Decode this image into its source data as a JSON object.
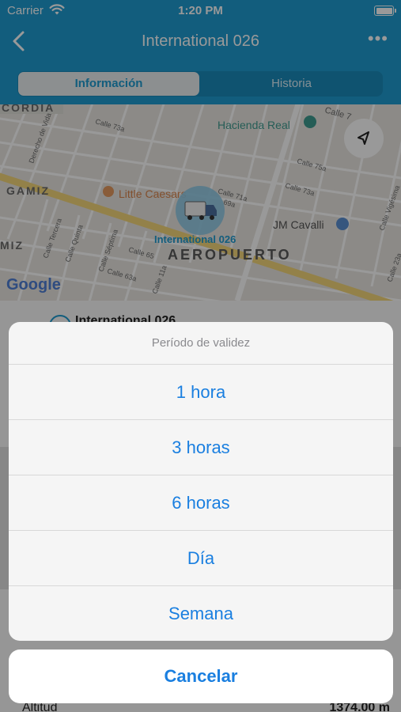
{
  "status_bar": {
    "carrier": "Carrier",
    "time": "1:20 PM"
  },
  "nav": {
    "title": "International 026"
  },
  "tabs": [
    {
      "label": "Información",
      "selected": true
    },
    {
      "label": "Historia",
      "selected": false
    }
  ],
  "map": {
    "labels": {
      "cordia": "CORDIA",
      "gamiz": "GAMIZ",
      "miz": "MIZ",
      "aeropuerto": "AEROPUERTO",
      "hacienda_real": "Hacienda Real",
      "little_caesars": "Little Caesars",
      "jm_cavalli": "JM Cavalli",
      "google": "Google",
      "vehicle": "International 026",
      "calle_73a": "Calle 73a",
      "calle_75a": "Calle 75a",
      "calle_73a_b": "Calle 73a",
      "calle_71a": "Calle 71a",
      "calle_69a": "69a",
      "calle_65": "Calle 65",
      "calle_63a": "Calle 63a",
      "calle_quinta": "Calle Quinta",
      "calle_tercera": "Calle Tercera",
      "calle_septima": "Calle Séptima",
      "calle_11a": "Calle 11a",
      "calle_vigesima": "Calle Vigésima",
      "calle_23a": "Calle 23a",
      "derecho_de_vida": "Derecho de Vida",
      "calle_top": "Calle 7"
    }
  },
  "background": {
    "card_title": "International 026",
    "altitude_label": "Altitud",
    "altitude_value": "1374.00 m"
  },
  "action_sheet": {
    "title": "Período de validez",
    "options": [
      "1 hora",
      "3 horas",
      "6 horas",
      "Día",
      "Semana"
    ],
    "cancel": "Cancelar"
  },
  "colors": {
    "header": "#1f9bd0",
    "action_blue": "#1a7fe0",
    "vehicle_label": "#1f9bd0"
  },
  "icons": [
    "back-chevron-icon",
    "more-icon",
    "wifi-icon",
    "battery-icon",
    "location-arrow-icon",
    "truck-icon",
    "pin-icon"
  ]
}
